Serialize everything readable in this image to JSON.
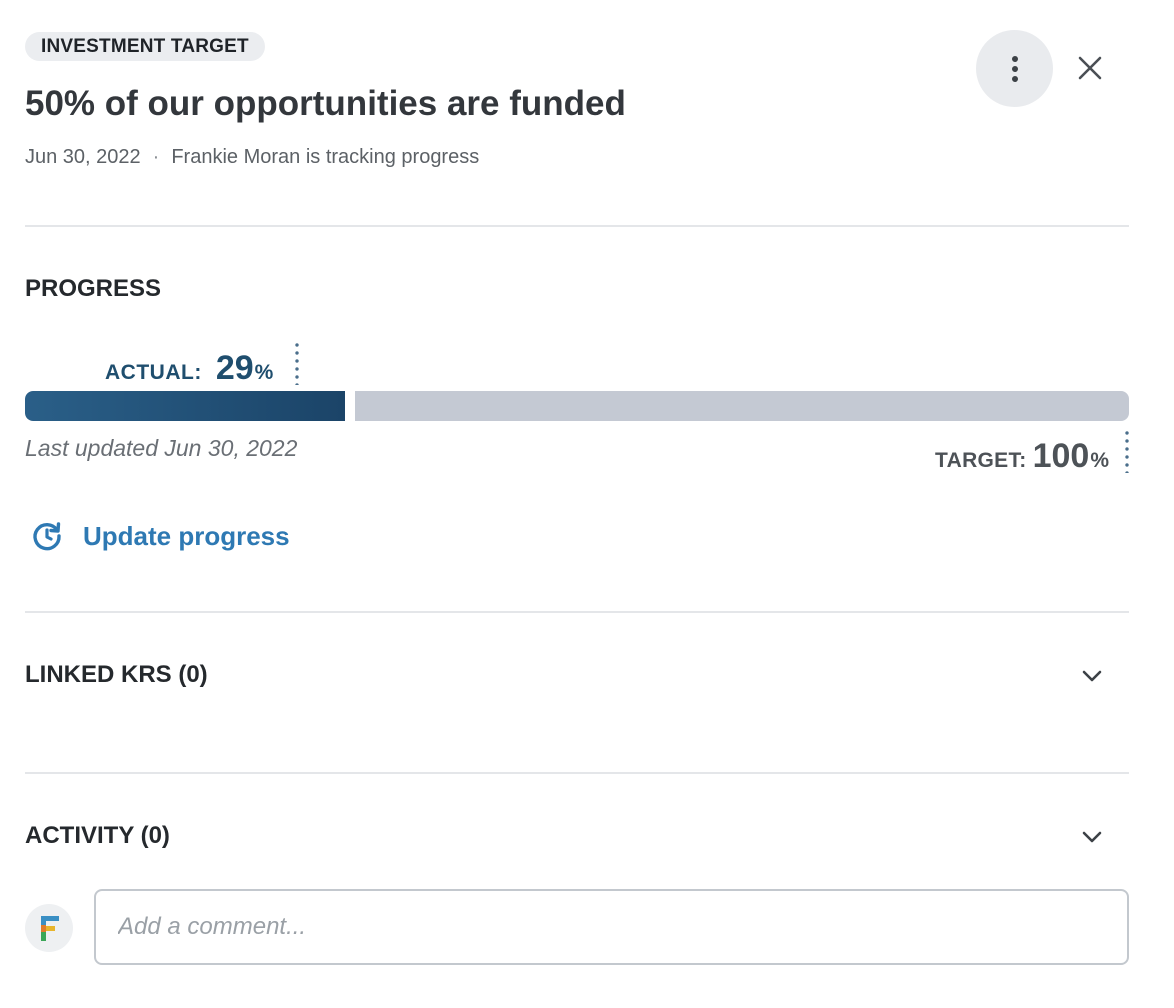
{
  "header": {
    "tag": "INVESTMENT TARGET",
    "title": "50% of our opportunities are funded",
    "date": "Jun 30, 2022",
    "separator": "·",
    "tracking_text": "Frankie Moran is tracking progress",
    "menu_icon": "more-vertical-icon",
    "close_icon": "close-icon"
  },
  "progress": {
    "section_title": "PROGRESS",
    "actual_label": "ACTUAL:",
    "actual_value": "29",
    "actual_unit": "%",
    "actual_fraction": 0.29,
    "last_updated": "Last updated Jun 30, 2022",
    "target_label": "TARGET:",
    "target_value": "100",
    "target_unit": "%",
    "update_label": "Update progress",
    "update_icon": "refresh-clock-icon",
    "fill_color": "#1f4e73",
    "track_color": "#c4c9d3",
    "link_color": "#2e79b3"
  },
  "linked_krs": {
    "title": "LINKED KRS (0)",
    "toggle_icon": "chevron-down-icon"
  },
  "activity": {
    "title": "ACTIVITY (0)",
    "toggle_icon": "chevron-down-icon",
    "avatar_letter": "F",
    "comment_placeholder": "Add a comment...",
    "comment_value": ""
  }
}
